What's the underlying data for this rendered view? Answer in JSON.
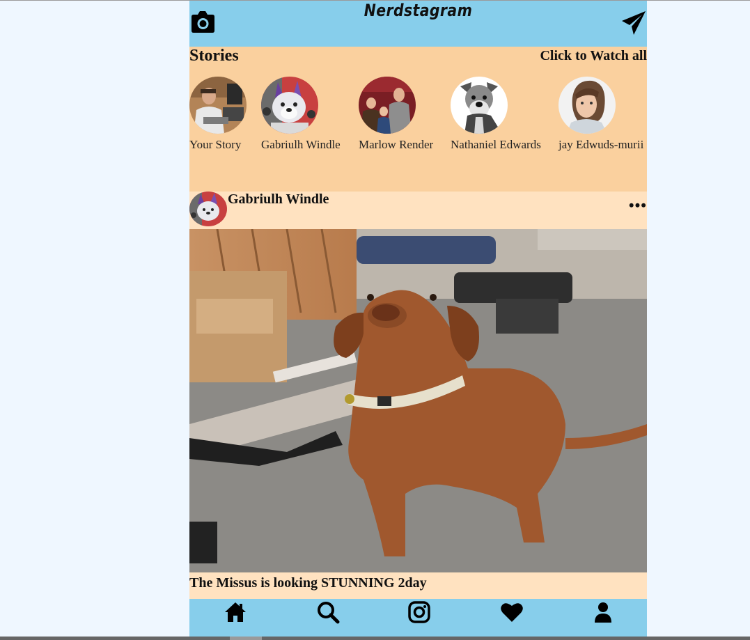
{
  "header": {
    "title": "Nerdstagram",
    "camera_icon": "camera-icon",
    "send_icon": "paper-plane-icon",
    "color": "#87ceeb"
  },
  "stories": {
    "heading": "Stories",
    "watch_all": "Click to Watch all",
    "background": "#fad09e",
    "items": [
      {
        "name": "Your Story"
      },
      {
        "name": "Gabriulh Windle"
      },
      {
        "name": "Marlow Render"
      },
      {
        "name": "Nathaniel Edwards"
      },
      {
        "name": "jay Edwuds-murii"
      }
    ]
  },
  "post": {
    "username": "Gabriulh Windle",
    "more_label": "•••",
    "caption": "The Missus is looking STUNNING 2day",
    "background": "#ffe2c0"
  },
  "nav": {
    "items": [
      {
        "icon": "home-icon"
      },
      {
        "icon": "search-icon"
      },
      {
        "icon": "instagram-icon"
      },
      {
        "icon": "heart-icon"
      },
      {
        "icon": "user-icon"
      }
    ]
  }
}
